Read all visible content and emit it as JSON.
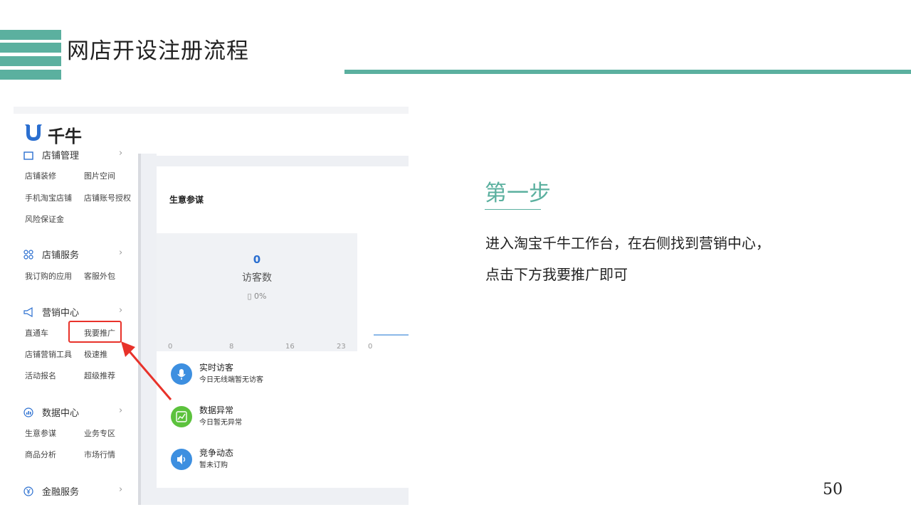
{
  "slide": {
    "title": "网店开设注册流程",
    "step_title": "第一步",
    "desc_line1": "进入淘宝千牛工作台，在右侧找到营销中心，",
    "desc_line2": "点击下方我要推广即可",
    "page_number": "50"
  },
  "screenshot": {
    "app_name": "千牛",
    "sidebar": {
      "store_manage": {
        "label": "店铺管理",
        "items": [
          "店铺装修",
          "图片空间",
          "手机淘宝店铺",
          "店铺账号授权",
          "风险保证金"
        ]
      },
      "store_service": {
        "label": "店铺服务",
        "items": [
          "我订购的应用",
          "客服外包"
        ]
      },
      "marketing": {
        "label": "营销中心",
        "items": [
          "直通车",
          "我要推广",
          "店铺营销工具",
          "极速推",
          "活动报名",
          "超级推荐"
        ]
      },
      "data_center": {
        "label": "数据中心",
        "items": [
          "生意参谋",
          "业务专区",
          "商品分析",
          "市场行情"
        ]
      },
      "finance": {
        "label": "金融服务"
      },
      "chevron": "›"
    },
    "card": {
      "title": "生意参谋",
      "visitor_value": "0",
      "visitor_label": "访客数",
      "mobile_pct": "0%",
      "axis_ticks": [
        "0",
        "8",
        "16",
        "23"
      ],
      "axis_ticks_2": "0"
    },
    "list": [
      {
        "title": "实时访客",
        "sub": "今日无线端暂无访客",
        "color": "#3d8fe0"
      },
      {
        "title": "数据异常",
        "sub": "今日暂无异常",
        "color": "#5cc23d"
      },
      {
        "title": "竞争动态",
        "sub": "暂未订购",
        "color": "#3d8fe0"
      }
    ],
    "highlight_color": "#e8322a",
    "accent_color": "#5bb09f"
  }
}
